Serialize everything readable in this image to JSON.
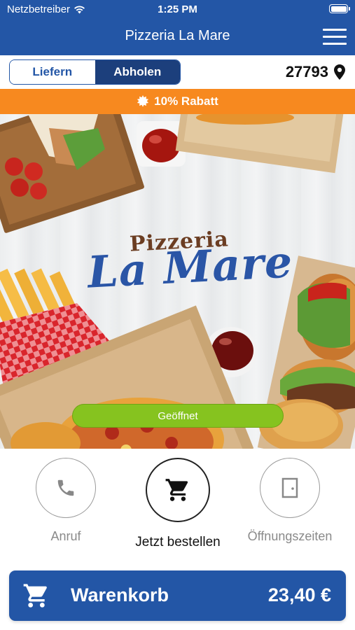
{
  "status_bar": {
    "carrier": "Netzbetreiber",
    "time": "1:25 PM"
  },
  "nav": {
    "title": "Pizzeria La Mare"
  },
  "mode": {
    "delivery_label": "Liefern",
    "pickup_label": "Abholen",
    "selected": "Abholen",
    "postcode": "27793"
  },
  "discount": {
    "label": "10% Rabatt"
  },
  "hero": {
    "logo_line1": "Pizzeria",
    "logo_line2": "La Mare",
    "status_label": "Geöffnet"
  },
  "actions": {
    "call_label": "Anruf",
    "order_label": "Jetzt bestellen",
    "hours_label": "Öffnungszeiten"
  },
  "cart": {
    "label": "Warenkorb",
    "total": "23,40 €"
  },
  "colors": {
    "brand": "#2356a6",
    "discount": "#f7891f",
    "open": "#86c31f",
    "segment_active": "#1c3f7c"
  }
}
